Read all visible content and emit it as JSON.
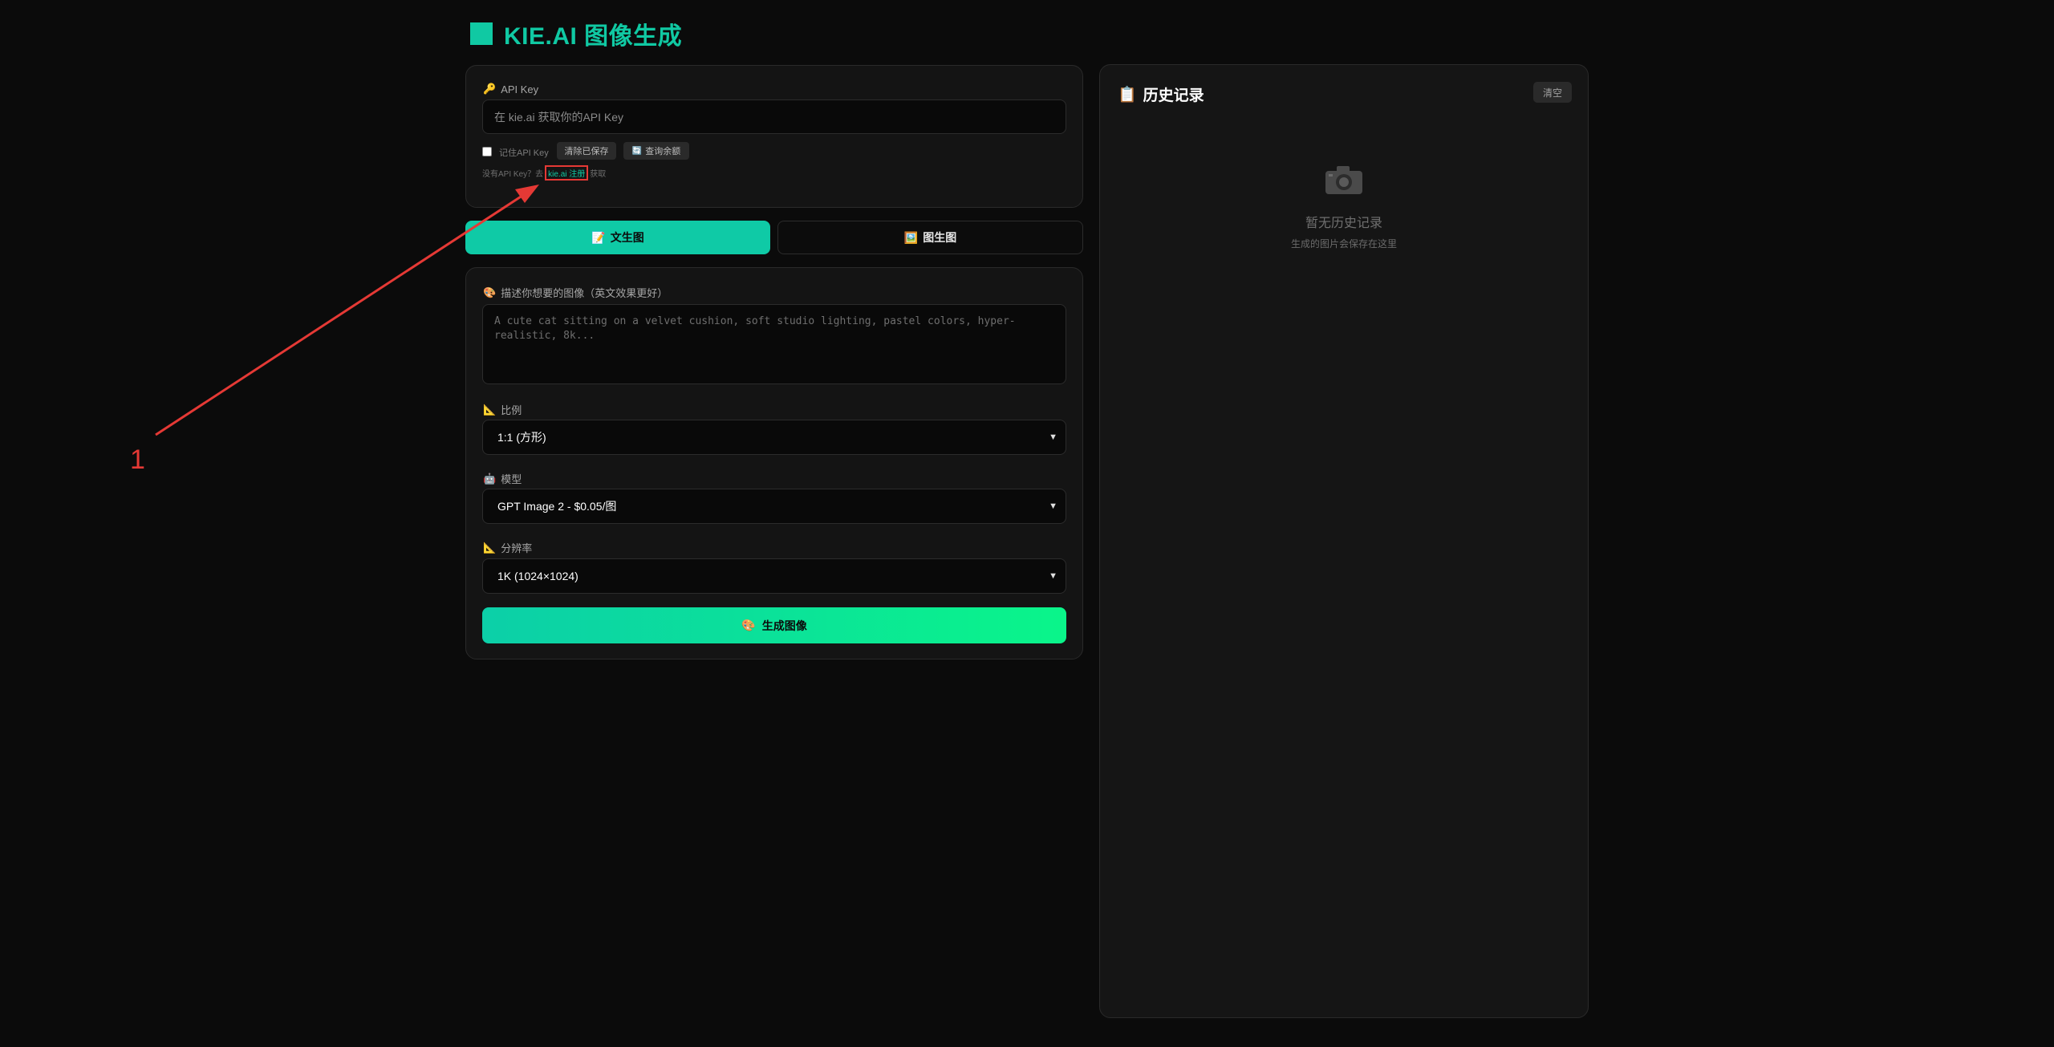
{
  "header": {
    "title": "KIE.AI 图像生成"
  },
  "api": {
    "label": "API Key",
    "label_icon": "🔑",
    "input_placeholder": "在 kie.ai 获取你的API Key",
    "remember_label": "记住API Key",
    "clear_saved_label": "清除已保存",
    "check_balance_label": "查询余额",
    "check_balance_icon": "🔄",
    "hint_prefix": "没有API Key？去",
    "hint_link": "kie.ai 注册",
    "hint_suffix": "获取"
  },
  "tabs": [
    {
      "label": "文生图",
      "icon": "📝"
    },
    {
      "label": "图生图",
      "icon": "🖼️"
    }
  ],
  "prompt": {
    "label": "描述你想要的图像（英文效果更好）",
    "label_icon": "🎨",
    "placeholder": "A cute cat sitting on a velvet cushion, soft studio lighting, pastel colors, hyper-realistic, 8k..."
  },
  "ratio": {
    "label": "比例",
    "label_icon": "📐",
    "value": "1:1 (方形)"
  },
  "model": {
    "label": "模型",
    "label_icon": "🤖",
    "value": "GPT Image 2 - $0.05/图"
  },
  "resolution": {
    "label": "分辨率",
    "label_icon": "📐",
    "value": "1K (1024×1024)"
  },
  "generate": {
    "label": "生成图像",
    "icon": "🎨"
  },
  "history": {
    "title": "历史记录",
    "title_icon": "📋",
    "clear_label": "清空",
    "empty_title": "暂无历史记录",
    "empty_sub": "生成的图片会保存在这里"
  },
  "annotation": {
    "number": "1"
  },
  "colors": {
    "accent": "#10c9a3",
    "annotation": "#e53935"
  }
}
